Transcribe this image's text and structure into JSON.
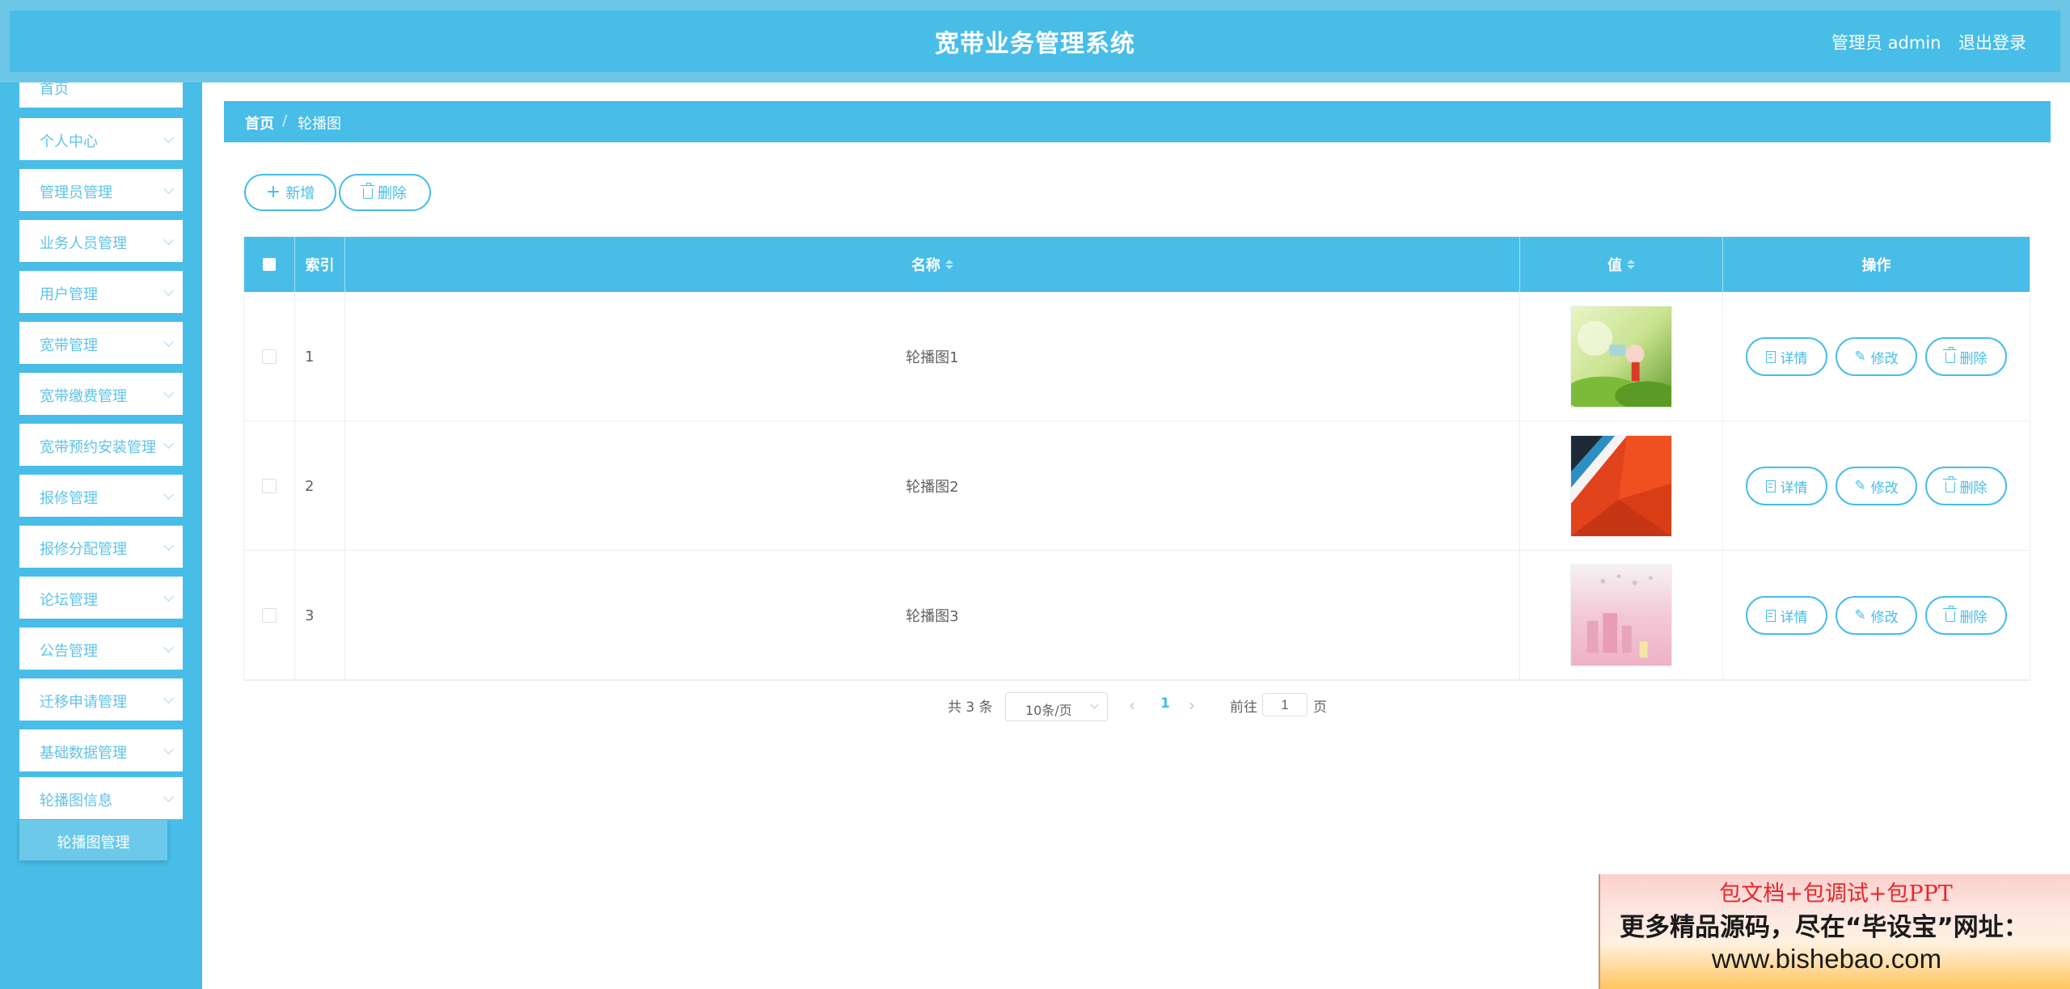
{
  "header": {
    "title": "宽带业务管理系统",
    "user": "管理员 admin",
    "logout": "退出登录"
  },
  "sidebar": {
    "items": [
      {
        "label": "首页"
      },
      {
        "label": "个人中心"
      },
      {
        "label": "管理员管理"
      },
      {
        "label": "业务人员管理"
      },
      {
        "label": "用户管理"
      },
      {
        "label": "宽带管理"
      },
      {
        "label": "宽带缴费管理"
      },
      {
        "label": "宽带预约安装管理"
      },
      {
        "label": "报修管理"
      },
      {
        "label": "报修分配管理"
      },
      {
        "label": "论坛管理"
      },
      {
        "label": "公告管理"
      },
      {
        "label": "迁移申请管理"
      },
      {
        "label": "基础数据管理"
      },
      {
        "label": "轮播图信息"
      }
    ],
    "active_submenu": "轮播图管理"
  },
  "breadcrumb": {
    "home": "首页",
    "separator": "/",
    "current": "轮播图"
  },
  "actions": {
    "add": "新增",
    "delete": "删除"
  },
  "table": {
    "columns": {
      "index": "索引",
      "name": "名称",
      "value": "值",
      "ops": "操作"
    },
    "rows": [
      {
        "index": "1",
        "name": "轮播图1",
        "image": "green-nature-photo"
      },
      {
        "index": "2",
        "name": "轮播图2",
        "image": "red-orange-abstract"
      },
      {
        "index": "3",
        "name": "轮播图3",
        "image": "pink-castle-illustration"
      }
    ],
    "row_actions": {
      "detail": "详情",
      "edit": "修改",
      "delete": "删除"
    }
  },
  "pagination": {
    "total": "共 3 条",
    "page_size": "10条/页",
    "current_page": "1",
    "goto_label": "前往",
    "goto_value": "1",
    "goto_unit": "页"
  },
  "watermark": {
    "line1": "包文档+包调试+包PPT",
    "line2": "更多精品源码，尽在“毕设宝”网址：",
    "line3": "www.bishebao.com"
  },
  "colors": {
    "primary": "#47bde8",
    "header_outer": "#6dc6e6",
    "submenu_active": "#6cc9ea",
    "watermark_red": "#e8262b"
  }
}
